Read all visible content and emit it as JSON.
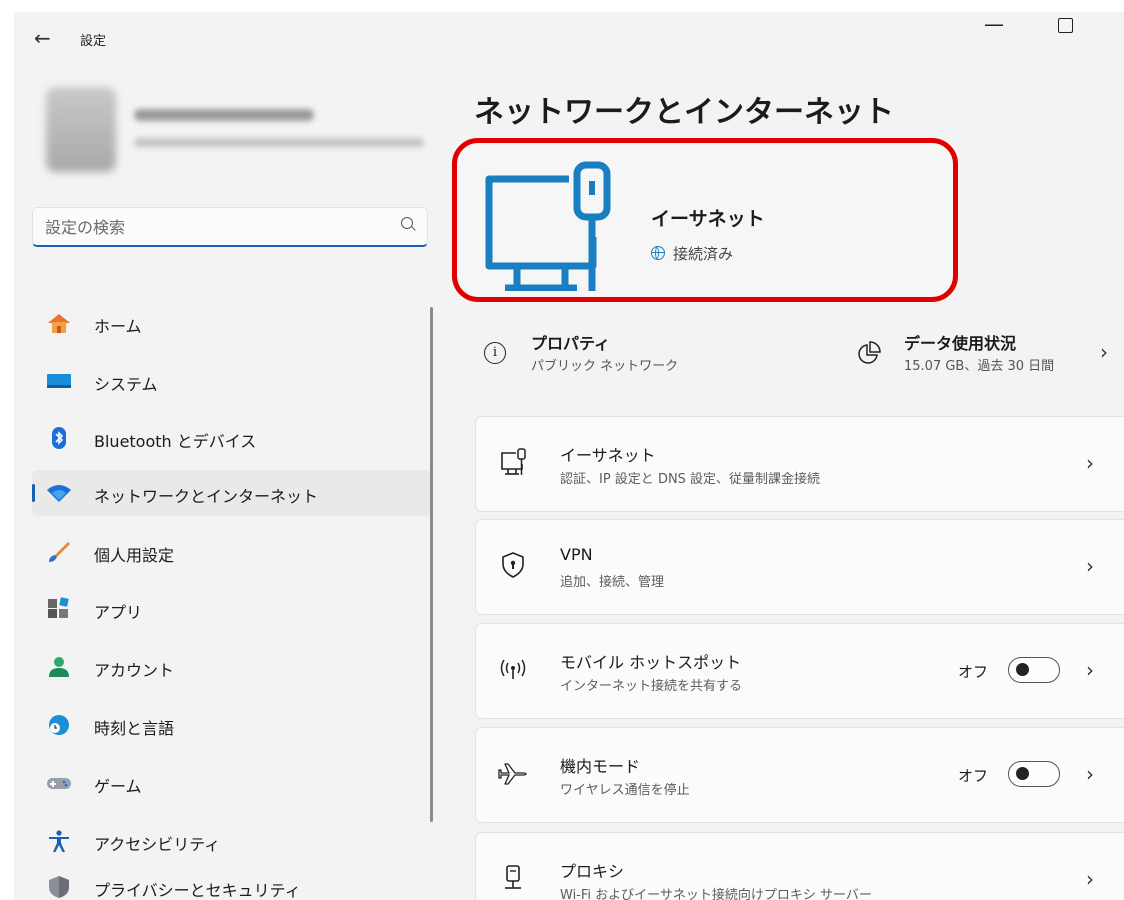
{
  "window": {
    "title": "設定"
  },
  "search": {
    "placeholder": "設定の検索"
  },
  "sidebar": {
    "items": [
      {
        "label": "ホーム",
        "icon": "home-icon"
      },
      {
        "label": "システム",
        "icon": "system-icon"
      },
      {
        "label": "Bluetooth とデバイス",
        "icon": "bluetooth-icon"
      },
      {
        "label": "ネットワークとインターネット",
        "icon": "wifi-icon",
        "active": true
      },
      {
        "label": "個人用設定",
        "icon": "brush-icon"
      },
      {
        "label": "アプリ",
        "icon": "apps-icon"
      },
      {
        "label": "アカウント",
        "icon": "account-icon"
      },
      {
        "label": "時刻と言語",
        "icon": "clock-globe-icon"
      },
      {
        "label": "ゲーム",
        "icon": "gamepad-icon"
      },
      {
        "label": "アクセシビリティ",
        "icon": "accessibility-icon"
      },
      {
        "label": "プライバシーとセキュリティ",
        "icon": "shield-icon"
      }
    ]
  },
  "main": {
    "title": "ネットワークとインターネット",
    "hero": {
      "name": "イーサネット",
      "status": "接続済み",
      "highlight_color": "#e00000"
    },
    "properties": {
      "title": "プロパティ",
      "subtitle": "パブリック ネットワーク"
    },
    "usage": {
      "title": "データ使用状況",
      "subtitle": "15.07 GB、過去 30 日間"
    },
    "cards": [
      {
        "title": "イーサネット",
        "subtitle": "認証、IP 設定と DNS 設定、従量制課金接続",
        "icon": "ethernet-icon"
      },
      {
        "title": "VPN",
        "subtitle": "追加、接続、管理",
        "icon": "vpn-shield-icon"
      },
      {
        "title": "モバイル ホットスポット",
        "subtitle": "インターネット接続を共有する",
        "icon": "hotspot-icon",
        "toggle_label": "オフ",
        "toggle_on": false
      },
      {
        "title": "機内モード",
        "subtitle": "ワイヤレス通信を停止",
        "icon": "airplane-icon",
        "toggle_label": "オフ",
        "toggle_on": false
      },
      {
        "title": "プロキシ",
        "subtitle": "Wi-Fi およびイーサネット接続向けプロキシ サーバー",
        "icon": "proxy-icon"
      }
    ]
  },
  "colors": {
    "accent": "#1a5fb4",
    "icon_blue": "#1a7fc1"
  }
}
